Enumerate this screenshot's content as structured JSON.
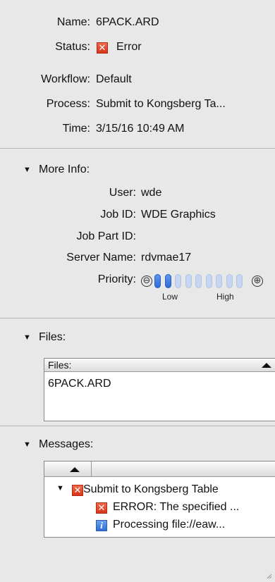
{
  "summary": {
    "name_label": "Name:",
    "name_value": "6PACK.ARD",
    "status_label": "Status:",
    "status_icon": "error-icon",
    "status_value": "Error",
    "workflow_label": "Workflow:",
    "workflow_value": "Default",
    "process_label": "Process:",
    "process_value": "Submit to Kongsberg Ta...",
    "time_label": "Time:",
    "time_value": "3/15/16 10:49 AM"
  },
  "more_info": {
    "header": "More Info:",
    "user_label": "User:",
    "user_value": "wde",
    "job_id_label": "Job ID:",
    "job_id_value": "WDE Graphics",
    "job_part_id_label": "Job Part ID:",
    "job_part_id_value": "",
    "server_label": "Server Name:",
    "server_value": "rdvmae17",
    "priority_label": "Priority:",
    "priority_level": 2,
    "priority_max": 9,
    "priority_low": "Low",
    "priority_high": "High",
    "minus_symbol": "⊖",
    "plus_symbol": "⊕"
  },
  "files": {
    "header": "Files:",
    "column_header": "Files:",
    "rows": [
      "6PACK.ARD"
    ]
  },
  "messages": {
    "header": "Messages:",
    "parent": {
      "icon": "error-icon",
      "text": "Submit to Kongsberg Table"
    },
    "children": [
      {
        "icon": "error-icon",
        "text": "ERROR: The specified ..."
      },
      {
        "icon": "info-icon",
        "text": "Processing file://eaw..."
      }
    ]
  },
  "colors": {
    "accent": "#2d6bd8",
    "error": "#d9341a",
    "panel_bg": "#e8e8e8"
  }
}
